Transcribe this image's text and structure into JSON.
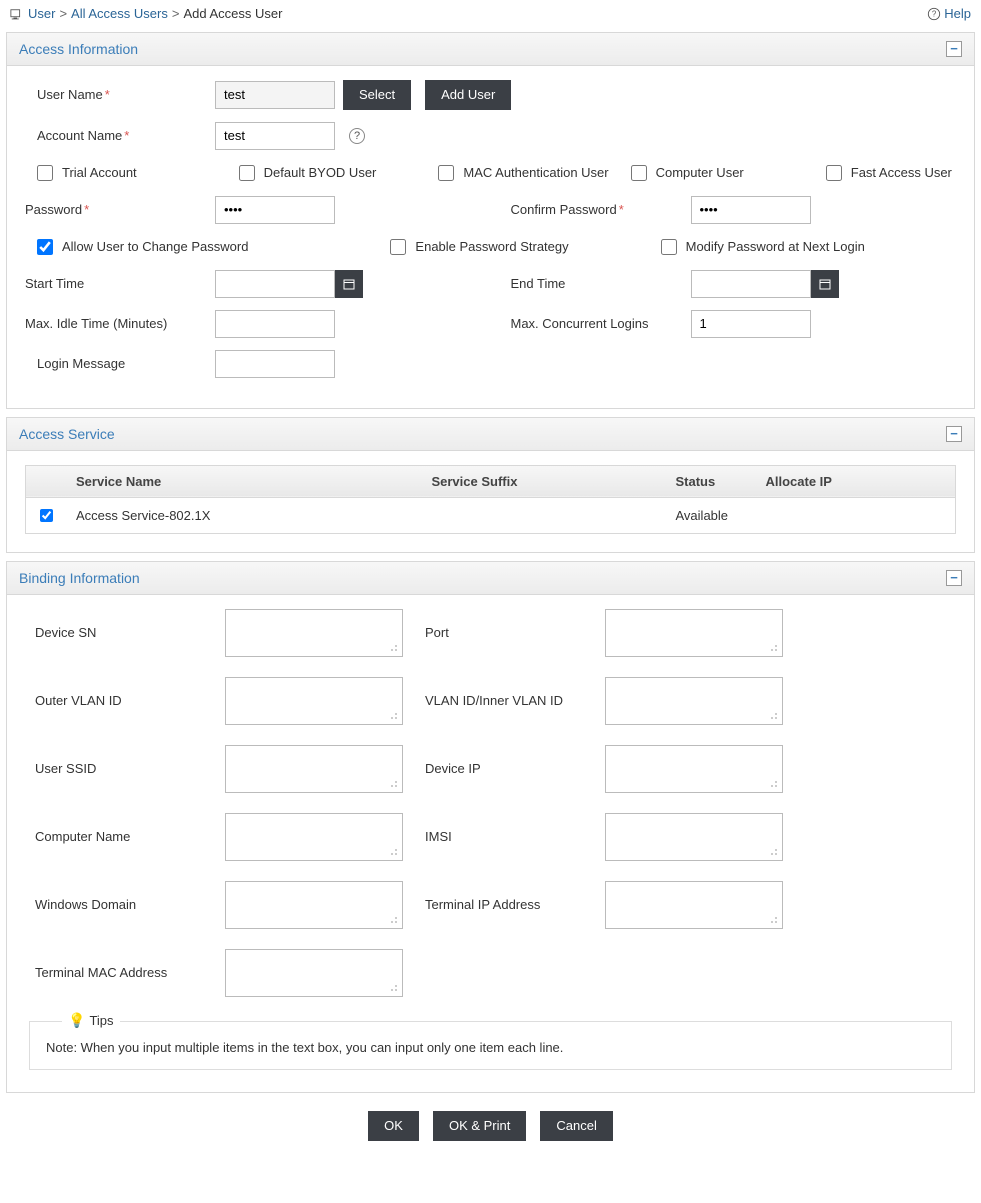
{
  "breadcrumb": {
    "user": "User",
    "all_users": "All Access Users",
    "current": "Add Access User"
  },
  "help_label": "Help",
  "panels": {
    "access_info": {
      "title": "Access Information",
      "fields": {
        "user_name_label": "User Name",
        "user_name_value": "test",
        "select_btn": "Select",
        "add_user_btn": "Add User",
        "account_name_label": "Account Name",
        "account_name_value": "test",
        "trial_account": "Trial Account",
        "default_byod": "Default BYOD User",
        "mac_auth": "MAC Authentication User",
        "computer_user": "Computer User",
        "fast_access": "Fast Access User",
        "password_label": "Password",
        "password_value": "••••",
        "confirm_password_label": "Confirm Password",
        "confirm_password_value": "••••",
        "allow_change_pw": "Allow User to Change Password",
        "enable_pw_strategy": "Enable Password Strategy",
        "modify_pw_next": "Modify Password at Next Login",
        "start_time_label": "Start Time",
        "start_time_value": "",
        "end_time_label": "End Time",
        "end_time_value": "",
        "max_idle_label": "Max. Idle Time (Minutes)",
        "max_idle_value": "",
        "max_conc_label": "Max. Concurrent Logins",
        "max_conc_value": "1",
        "login_msg_label": "Login Message",
        "login_msg_value": ""
      }
    },
    "access_service": {
      "title": "Access Service",
      "columns": {
        "name": "Service Name",
        "suffix": "Service Suffix",
        "status": "Status",
        "allocate": "Allocate IP"
      },
      "rows": [
        {
          "checked": true,
          "name": "Access Service-802.1X",
          "suffix": "",
          "status": "Available",
          "allocate": ""
        }
      ]
    },
    "binding": {
      "title": "Binding Information",
      "fields": {
        "device_sn": "Device SN",
        "port": "Port",
        "outer_vlan": "Outer VLAN ID",
        "inner_vlan": "VLAN ID/Inner VLAN ID",
        "user_ssid": "User SSID",
        "device_ip": "Device IP",
        "computer_name": "Computer Name",
        "imsi": "IMSI",
        "windows_domain": "Windows Domain",
        "terminal_ip": "Terminal IP Address",
        "terminal_mac": "Terminal MAC Address"
      },
      "tips_title": "Tips",
      "tips_note": "Note: When you input multiple items in the text box, you can input only one item each line."
    }
  },
  "footer": {
    "ok": "OK",
    "ok_print": "OK & Print",
    "cancel": "Cancel"
  }
}
